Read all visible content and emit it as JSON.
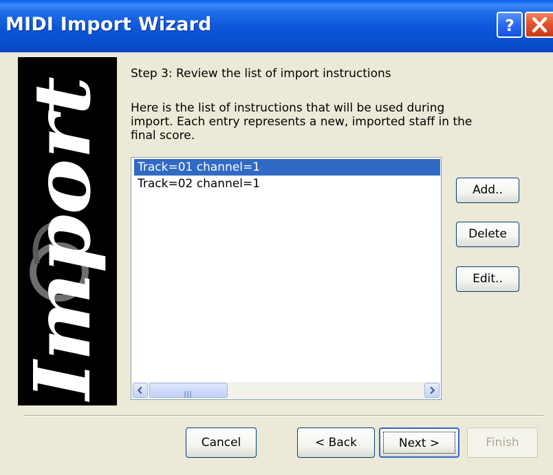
{
  "window": {
    "title": "MIDI Import Wizard",
    "help_icon": "question-mark-icon",
    "close_icon": "close-x-icon"
  },
  "banner": {
    "text": "Import"
  },
  "content": {
    "step_heading": "Step 3: Review the list of import instructions",
    "description_lines": [
      "Here is the list of instructions that will be used during",
      "import. Each entry represents a new, imported staff in the",
      "final score."
    ]
  },
  "instructions": {
    "items": [
      {
        "label": "Track=01  channel=1",
        "selected": true
      },
      {
        "label": "Track=02  channel=1",
        "selected": false
      }
    ]
  },
  "side_buttons": {
    "add": "Add..",
    "delete": "Delete",
    "edit": "Edit.."
  },
  "nav_buttons": {
    "cancel": "Cancel",
    "back": "< Back",
    "next": "Next >",
    "finish": "Finish"
  },
  "colors": {
    "titlebar": "#0a55d8",
    "selection": "#316ac5",
    "dialog_bg": "#ece9d8"
  }
}
